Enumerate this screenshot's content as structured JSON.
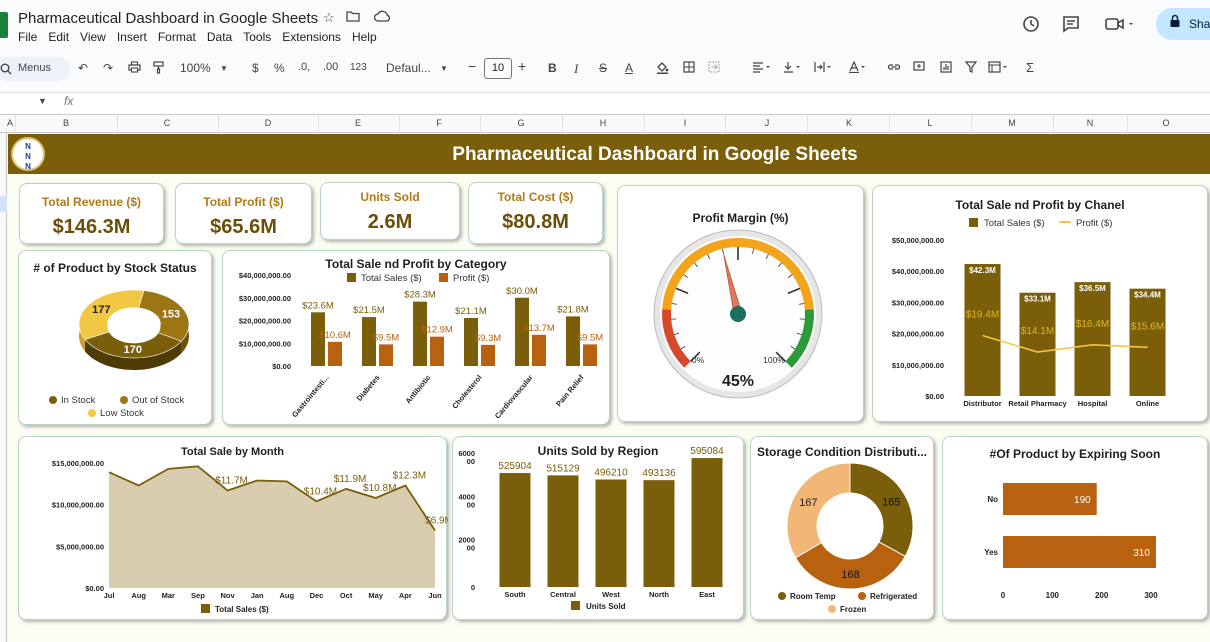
{
  "app": {
    "doc_title": "Pharmaceutical Dashboard in Google Sheets",
    "menu": [
      "File",
      "Edit",
      "View",
      "Insert",
      "Format",
      "Data",
      "Tools",
      "Extensions",
      "Help"
    ],
    "share_label": "Sha",
    "icons": [
      "star-icon",
      "move-folder-icon",
      "cloud-status-icon",
      "history-icon",
      "comment-icon",
      "video-icon",
      "lock-icon"
    ]
  },
  "toolbar": {
    "menus_label": "Menus",
    "zoom": "100%",
    "currency": "$",
    "percent": "%",
    "dec_decrease": ".0,",
    "dec_increase": ".00",
    "number_format": "123",
    "font": "Defaul...",
    "font_size": "10",
    "bold": "B",
    "italic": "I",
    "strike": "S",
    "text_color": "A",
    "sigma": "Σ"
  },
  "formula_bar": {
    "fx": "fx"
  },
  "columns": [
    "A",
    "B",
    "C",
    "D",
    "E",
    "F",
    "G",
    "H",
    "I",
    "J",
    "K",
    "L",
    "M",
    "N",
    "O"
  ],
  "dashboard": {
    "banner_title": "Pharmaceutical Dashboard in Google Sheets",
    "logo_text": "N N N",
    "colors": {
      "dark": "#7a5e0a",
      "accent": "#b8620f",
      "light": "#f2c744",
      "peach": "#f2b774"
    },
    "kpis": [
      {
        "label": "Total Revenue ($)",
        "value": "$146.3M"
      },
      {
        "label": "Total Profit ($)",
        "value": "$65.6M"
      },
      {
        "label": "Units Sold",
        "value": "2.6M"
      },
      {
        "label": "Total Cost ($)",
        "value": "$80.8M"
      }
    ]
  },
  "chart_data": [
    {
      "id": "stock-status",
      "type": "pie",
      "title": "# of  Product by Stock Status",
      "slices": [
        {
          "name": "In Stock",
          "value": 170,
          "color": "#7a5e0a"
        },
        {
          "name": "Out of Stock",
          "value": 153,
          "color": "#9c7614"
        },
        {
          "name": "Low Stock",
          "value": 177,
          "color": "#f2c744"
        }
      ]
    },
    {
      "id": "category",
      "type": "bar",
      "title": "Total Sale nd Profit by Category",
      "categories": [
        "Gastrointesti...",
        "Diabetes",
        "Antibiotic",
        "Cholesterol",
        "Cardiovascular",
        "Pain Relief"
      ],
      "series": [
        {
          "name": "Total Sales ($)",
          "values": [
            23.6,
            21.5,
            28.3,
            21.1,
            30.0,
            21.8
          ],
          "labels": [
            "$23.6M",
            "$21.5M",
            "$28.3M",
            "$21.1M",
            "$30.0M",
            "$21.8M"
          ],
          "color": "#7a5e0a"
        },
        {
          "name": "Profit ($)",
          "values": [
            10.6,
            9.5,
            12.9,
            9.3,
            13.7,
            9.5
          ],
          "labels": [
            "$10.6M",
            "$9.5M",
            "$12.9M",
            "$9.3M",
            "$13.7M",
            "$9.5M"
          ],
          "color": "#b8620f"
        }
      ],
      "ylim": [
        0,
        40
      ],
      "yticks": [
        "$0.00",
        "$10,000,000.00",
        "$20,000,000.00",
        "$30,000,000.00",
        "$40,000,000.00"
      ]
    },
    {
      "id": "profit-margin",
      "type": "gauge",
      "title": "Profit Margin (%)",
      "value": 45,
      "value_label": "45%",
      "min_label": "0%",
      "max_label": "100%"
    },
    {
      "id": "channel",
      "type": "bar",
      "title": "Total Sale nd Profit by Chanel",
      "categories": [
        "Distributor",
        "Retail Pharmacy",
        "Hospital",
        "Online"
      ],
      "series": [
        {
          "name": "Total Sales ($)",
          "values": [
            42.3,
            33.1,
            36.5,
            34.4
          ],
          "labels": [
            "$42.3M",
            "$33.1M",
            "$36.5M",
            "$34.4M"
          ],
          "color": "#7a5e0a"
        },
        {
          "name": "Profit ($)",
          "values": [
            19.4,
            14.1,
            16.4,
            15.6
          ],
          "labels": [
            "$19.4M",
            "$14.1M",
            "$16.4M",
            "$15.6M"
          ],
          "color": "#f2c744"
        }
      ],
      "ylim": [
        0,
        50
      ],
      "yticks": [
        "$0.00",
        "$10,000,000.00",
        "$20,000,000.00",
        "$30,000,000.00",
        "$40,000,000.00",
        "$50,000,000.00"
      ]
    },
    {
      "id": "month",
      "type": "area",
      "title": "Total Sale by Month",
      "categories": [
        "Jul",
        "Aug",
        "Mar",
        "Sep",
        "Nov",
        "Jan",
        "Aug",
        "Dec",
        "Oct",
        "May",
        "Apr",
        "Jun"
      ],
      "series": [
        {
          "name": "Total Sales ($)",
          "values": [
            13.9,
            12.3,
            14.3,
            14.6,
            11.7,
            12.9,
            12.8,
            10.4,
            11.9,
            10.8,
            12.3,
            6.9
          ],
          "color": "#7a5e0a"
        }
      ],
      "labels": [
        {
          "index": 4,
          "text": "$11.7M"
        },
        {
          "index": 7,
          "text": "$10.4M"
        },
        {
          "index": 8,
          "text": "$11.9M"
        },
        {
          "index": 9,
          "text": "$10.8M"
        },
        {
          "index": 10,
          "text": "$12.3M"
        },
        {
          "index": 11,
          "text": "$6.9M"
        }
      ],
      "ylim": [
        0,
        15
      ],
      "yticks": [
        "$0.00",
        "$5,000,000.00",
        "$10,000,000.00",
        "$15,000,000.00"
      ]
    },
    {
      "id": "region",
      "type": "bar",
      "title": "Units Sold by Region",
      "categories": [
        "South",
        "Central",
        "West",
        "North",
        "East"
      ],
      "series": [
        {
          "name": "Units Sold",
          "values": [
            525904,
            515129,
            496210,
            493136,
            595084
          ],
          "labels": [
            "525904",
            "515129",
            "496210",
            "493136",
            "595084"
          ],
          "color": "#7a5e0a"
        }
      ],
      "ylim": [
        0,
        600000
      ],
      "yticks": [
        "0",
        "2000\n00",
        "4000\n00",
        "6000\n00"
      ]
    },
    {
      "id": "storage",
      "type": "pie",
      "title": "Storage Condition Distributi...",
      "slices": [
        {
          "name": "Room Temp",
          "value": 165,
          "color": "#7a5e0a"
        },
        {
          "name": "Refrigerated",
          "value": 168,
          "color": "#b8620f"
        },
        {
          "name": "Frozen",
          "value": 167,
          "color": "#f2b774"
        }
      ]
    },
    {
      "id": "expiring",
      "type": "bar",
      "title": "#Of Product by Expiring Soon",
      "categories": [
        "No",
        "Yes"
      ],
      "series": [
        {
          "name": "",
          "values": [
            190,
            310
          ],
          "labels": [
            "190",
            "310"
          ],
          "color": "#b8620f"
        }
      ],
      "xlim": [
        0,
        300
      ],
      "xticks": [
        "0",
        "100",
        "200",
        "300"
      ]
    }
  ]
}
